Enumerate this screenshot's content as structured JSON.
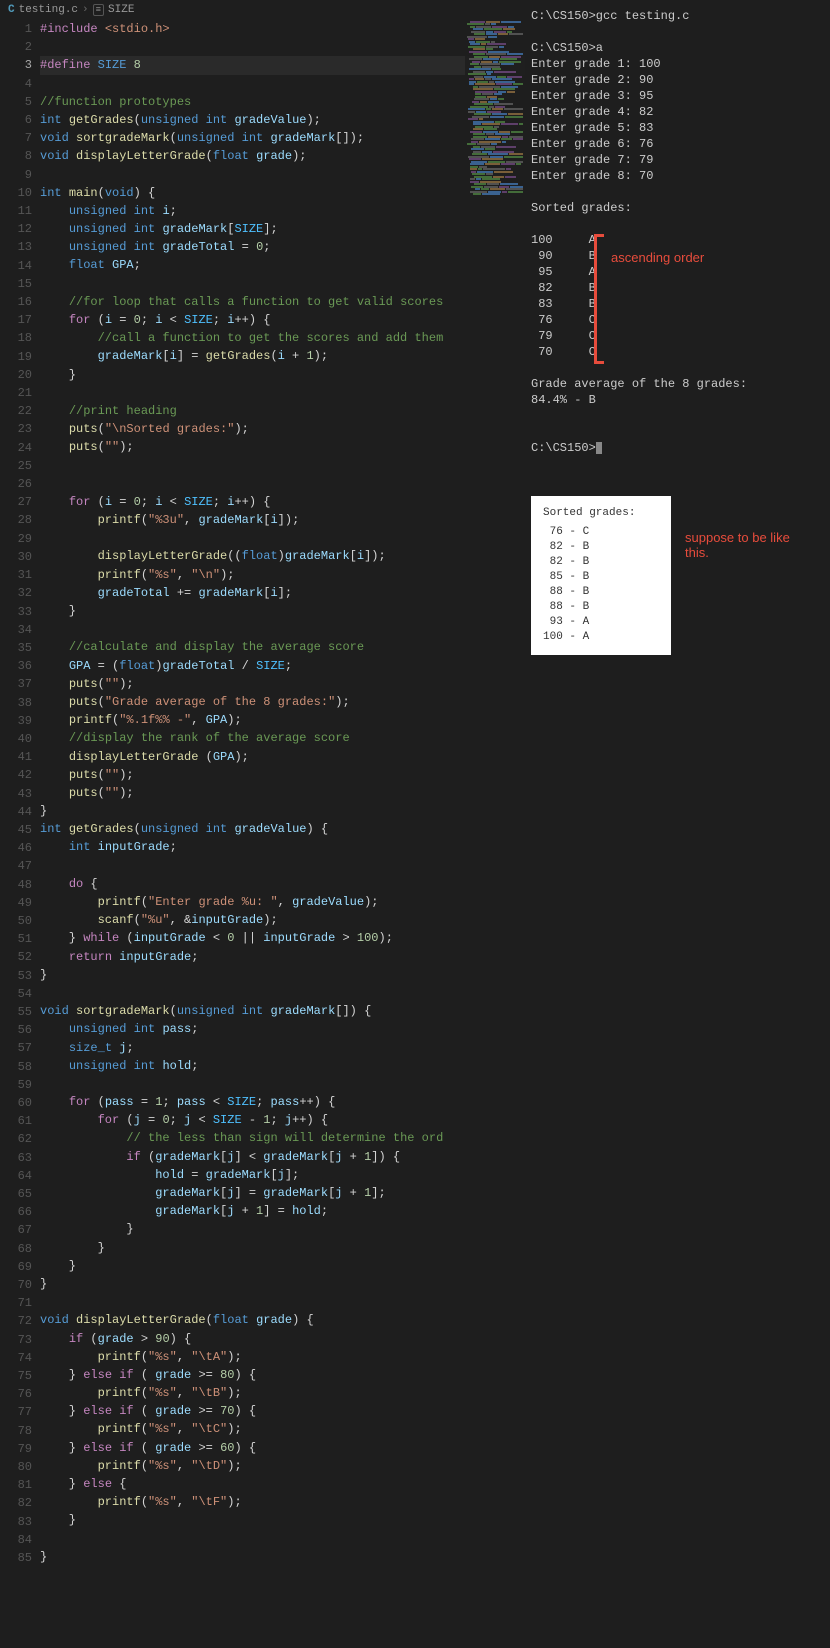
{
  "breadcrumb": {
    "icon": "C",
    "file": "testing.c",
    "symbol_icon": "SIZE",
    "symbol": "SIZE"
  },
  "code_lines": [
    {
      "n": 1,
      "h": "<span class='tk-include'>#include</span> <span class='tk-lib'>&lt;stdio.h&gt;</span>"
    },
    {
      "n": 2,
      "h": ""
    },
    {
      "n": 3,
      "h": "<span class='tk-include'>#define</span> <span class='tk-macro'>SIZE</span> <span class='tk-num'>8</span>",
      "active": true
    },
    {
      "n": 4,
      "h": ""
    },
    {
      "n": 5,
      "h": "<span class='tk-comment'>//function prototypes</span>"
    },
    {
      "n": 6,
      "h": "<span class='tk-type'>int</span> <span class='tk-func'>getGrades</span>(<span class='tk-type'>unsigned int</span> <span class='tk-var'>gradeValue</span>);"
    },
    {
      "n": 7,
      "h": "<span class='tk-type'>void</span> <span class='tk-func'>sortgradeMark</span>(<span class='tk-type'>unsigned int</span> <span class='tk-var'>gradeMark</span>[]);"
    },
    {
      "n": 8,
      "h": "<span class='tk-type'>void</span> <span class='tk-func'>displayLetterGrade</span>(<span class='tk-type'>float</span> <span class='tk-var'>grade</span>);"
    },
    {
      "n": 9,
      "h": ""
    },
    {
      "n": 10,
      "h": "<span class='tk-type'>int</span> <span class='tk-func'>main</span>(<span class='tk-type'>void</span>) {"
    },
    {
      "n": 11,
      "h": "    <span class='tk-type'>unsigned int</span> <span class='tk-var'>i</span>;"
    },
    {
      "n": 12,
      "h": "    <span class='tk-type'>unsigned int</span> <span class='tk-var'>gradeMark</span>[<span class='tk-const'>SIZE</span>];"
    },
    {
      "n": 13,
      "h": "    <span class='tk-type'>unsigned int</span> <span class='tk-var'>gradeTotal</span> = <span class='tk-num'>0</span>;"
    },
    {
      "n": 14,
      "h": "    <span class='tk-type'>float</span> <span class='tk-var'>GPA</span>;"
    },
    {
      "n": 15,
      "h": ""
    },
    {
      "n": 16,
      "h": "    <span class='tk-comment'>//for loop that calls a function to get valid scores</span>"
    },
    {
      "n": 17,
      "h": "    <span class='tk-ctrl'>for</span> (<span class='tk-var'>i</span> = <span class='tk-num'>0</span>; <span class='tk-var'>i</span> &lt; <span class='tk-const'>SIZE</span>; <span class='tk-var'>i</span>++) {"
    },
    {
      "n": 18,
      "h": "        <span class='tk-comment'>//call a function to get the scores and add them</span>"
    },
    {
      "n": 19,
      "h": "        <span class='tk-var'>gradeMark</span>[<span class='tk-var'>i</span>] = <span class='tk-func'>getGrades</span>(<span class='tk-var'>i</span> + <span class='tk-num'>1</span>);"
    },
    {
      "n": 20,
      "h": "    }"
    },
    {
      "n": 21,
      "h": ""
    },
    {
      "n": 22,
      "h": "    <span class='tk-comment'>//print heading</span>"
    },
    {
      "n": 23,
      "h": "    <span class='tk-func'>puts</span>(<span class='tk-str'>\"\\nSorted grades:\"</span>);"
    },
    {
      "n": 24,
      "h": "    <span class='tk-func'>puts</span>(<span class='tk-str'>\"\"</span>);"
    },
    {
      "n": 25,
      "h": ""
    },
    {
      "n": 26,
      "h": ""
    },
    {
      "n": 27,
      "h": "    <span class='tk-ctrl'>for</span> (<span class='tk-var'>i</span> = <span class='tk-num'>0</span>; <span class='tk-var'>i</span> &lt; <span class='tk-const'>SIZE</span>; <span class='tk-var'>i</span>++) {"
    },
    {
      "n": 28,
      "h": "        <span class='tk-func'>printf</span>(<span class='tk-str'>\"%3u\"</span>, <span class='tk-var'>gradeMark</span>[<span class='tk-var'>i</span>]);"
    },
    {
      "n": 29,
      "h": ""
    },
    {
      "n": 30,
      "h": "        <span class='tk-func'>displayLetterGrade</span>((<span class='tk-type'>float</span>)<span class='tk-var'>gradeMark</span>[<span class='tk-var'>i</span>]);"
    },
    {
      "n": 31,
      "h": "        <span class='tk-func'>printf</span>(<span class='tk-str'>\"%s\"</span>, <span class='tk-str'>\"\\n\"</span>);"
    },
    {
      "n": 32,
      "h": "        <span class='tk-var'>gradeTotal</span> += <span class='tk-var'>gradeMark</span>[<span class='tk-var'>i</span>];"
    },
    {
      "n": 33,
      "h": "    }"
    },
    {
      "n": 34,
      "h": ""
    },
    {
      "n": 35,
      "h": "    <span class='tk-comment'>//calculate and display the average score</span>"
    },
    {
      "n": 36,
      "h": "    <span class='tk-var'>GPA</span> = (<span class='tk-type'>float</span>)<span class='tk-var'>gradeTotal</span> / <span class='tk-const'>SIZE</span>;"
    },
    {
      "n": 37,
      "h": "    <span class='tk-func'>puts</span>(<span class='tk-str'>\"\"</span>);"
    },
    {
      "n": 38,
      "h": "    <span class='tk-func'>puts</span>(<span class='tk-str'>\"Grade average of the 8 grades:\"</span>);"
    },
    {
      "n": 39,
      "h": "    <span class='tk-func'>printf</span>(<span class='tk-str'>\"%.1f%% -\"</span>, <span class='tk-var'>GPA</span>);"
    },
    {
      "n": 40,
      "h": "    <span class='tk-comment'>//display the rank of the average score</span>"
    },
    {
      "n": 41,
      "h": "    <span class='tk-func'>displayLetterGrade</span> (<span class='tk-var'>GPA</span>);"
    },
    {
      "n": 42,
      "h": "    <span class='tk-func'>puts</span>(<span class='tk-str'>\"\"</span>);"
    },
    {
      "n": 43,
      "h": "    <span class='tk-func'>puts</span>(<span class='tk-str'>\"\"</span>);"
    },
    {
      "n": 44,
      "h": "}"
    },
    {
      "n": 45,
      "h": "<span class='tk-type'>int</span> <span class='tk-func'>getGrades</span>(<span class='tk-type'>unsigned int</span> <span class='tk-var'>gradeValue</span>) {"
    },
    {
      "n": 46,
      "h": "    <span class='tk-type'>int</span> <span class='tk-var'>inputGrade</span>;"
    },
    {
      "n": 47,
      "h": ""
    },
    {
      "n": 48,
      "h": "    <span class='tk-ctrl'>do</span> {"
    },
    {
      "n": 49,
      "h": "        <span class='tk-func'>printf</span>(<span class='tk-str'>\"Enter grade %u: \"</span>, <span class='tk-var'>gradeValue</span>);"
    },
    {
      "n": 50,
      "h": "        <span class='tk-func'>scanf</span>(<span class='tk-str'>\"%u\"</span>, &amp;<span class='tk-var'>inputGrade</span>);"
    },
    {
      "n": 51,
      "h": "    } <span class='tk-ctrl'>while</span> (<span class='tk-var'>inputGrade</span> &lt; <span class='tk-num'>0</span> || <span class='tk-var'>inputGrade</span> &gt; <span class='tk-num'>100</span>);"
    },
    {
      "n": 52,
      "h": "    <span class='tk-ctrl'>return</span> <span class='tk-var'>inputGrade</span>;"
    },
    {
      "n": 53,
      "h": "}"
    },
    {
      "n": 54,
      "h": ""
    },
    {
      "n": 55,
      "h": "<span class='tk-type'>void</span> <span class='tk-func'>sortgradeMark</span>(<span class='tk-type'>unsigned int</span> <span class='tk-var'>gradeMark</span>[]) {"
    },
    {
      "n": 56,
      "h": "    <span class='tk-type'>unsigned int</span> <span class='tk-var'>pass</span>;"
    },
    {
      "n": 57,
      "h": "    <span class='tk-type'>size_t</span> <span class='tk-var'>j</span>;"
    },
    {
      "n": 58,
      "h": "    <span class='tk-type'>unsigned int</span> <span class='tk-var'>hold</span>;"
    },
    {
      "n": 59,
      "h": ""
    },
    {
      "n": 60,
      "h": "    <span class='tk-ctrl'>for</span> (<span class='tk-var'>pass</span> = <span class='tk-num'>1</span>; <span class='tk-var'>pass</span> &lt; <span class='tk-const'>SIZE</span>; <span class='tk-var'>pass</span>++) {"
    },
    {
      "n": 61,
      "h": "        <span class='tk-ctrl'>for</span> (<span class='tk-var'>j</span> = <span class='tk-num'>0</span>; <span class='tk-var'>j</span> &lt; <span class='tk-const'>SIZE</span> - <span class='tk-num'>1</span>; <span class='tk-var'>j</span>++) {"
    },
    {
      "n": 62,
      "h": "            <span class='tk-comment'>// the less than sign will determine the ord</span>"
    },
    {
      "n": 63,
      "h": "            <span class='tk-ctrl'>if</span> (<span class='tk-var'>gradeMark</span>[<span class='tk-var'>j</span>] &lt; <span class='tk-var'>gradeMark</span>[<span class='tk-var'>j</span> + <span class='tk-num'>1</span>]) {"
    },
    {
      "n": 64,
      "h": "                <span class='tk-var'>hold</span> = <span class='tk-var'>gradeMark</span>[<span class='tk-var'>j</span>];"
    },
    {
      "n": 65,
      "h": "                <span class='tk-var'>gradeMark</span>[<span class='tk-var'>j</span>] = <span class='tk-var'>gradeMark</span>[<span class='tk-var'>j</span> + <span class='tk-num'>1</span>];"
    },
    {
      "n": 66,
      "h": "                <span class='tk-var'>gradeMark</span>[<span class='tk-var'>j</span> + <span class='tk-num'>1</span>] = <span class='tk-var'>hold</span>;"
    },
    {
      "n": 67,
      "h": "            }"
    },
    {
      "n": 68,
      "h": "        }"
    },
    {
      "n": 69,
      "h": "    }"
    },
    {
      "n": 70,
      "h": "}"
    },
    {
      "n": 71,
      "h": ""
    },
    {
      "n": 72,
      "h": "<span class='tk-type'>void</span> <span class='tk-func'>displayLetterGrade</span>(<span class='tk-type'>float</span> <span class='tk-var'>grade</span>) {"
    },
    {
      "n": 73,
      "h": "    <span class='tk-ctrl'>if</span> (<span class='tk-var'>grade</span> &gt; <span class='tk-num'>90</span>) {"
    },
    {
      "n": 74,
      "h": "        <span class='tk-func'>printf</span>(<span class='tk-str'>\"%s\"</span>, <span class='tk-str'>\"\\tA\"</span>);"
    },
    {
      "n": 75,
      "h": "    } <span class='tk-ctrl'>else if</span> ( <span class='tk-var'>grade</span> &gt;= <span class='tk-num'>80</span>) {"
    },
    {
      "n": 76,
      "h": "        <span class='tk-func'>printf</span>(<span class='tk-str'>\"%s\"</span>, <span class='tk-str'>\"\\tB\"</span>);"
    },
    {
      "n": 77,
      "h": "    } <span class='tk-ctrl'>else if</span> ( <span class='tk-var'>grade</span> &gt;= <span class='tk-num'>70</span>) {"
    },
    {
      "n": 78,
      "h": "        <span class='tk-func'>printf</span>(<span class='tk-str'>\"%s\"</span>, <span class='tk-str'>\"\\tC\"</span>);"
    },
    {
      "n": 79,
      "h": "    } <span class='tk-ctrl'>else if</span> ( <span class='tk-var'>grade</span> &gt;= <span class='tk-num'>60</span>) {"
    },
    {
      "n": 80,
      "h": "        <span class='tk-func'>printf</span>(<span class='tk-str'>\"%s\"</span>, <span class='tk-str'>\"\\tD\"</span>);"
    },
    {
      "n": 81,
      "h": "    } <span class='tk-ctrl'>else</span> {"
    },
    {
      "n": 82,
      "h": "        <span class='tk-func'>printf</span>(<span class='tk-str'>\"%s\"</span>, <span class='tk-str'>\"\\tF\"</span>);"
    },
    {
      "n": 83,
      "h": "    }"
    },
    {
      "n": 84,
      "h": ""
    },
    {
      "n": 85,
      "h": "}"
    }
  ],
  "terminal": {
    "lines": [
      "C:\\CS150>gcc testing.c",
      "",
      "C:\\CS150>a",
      "Enter grade 1: 100",
      "Enter grade 2: 90",
      "Enter grade 3: 95",
      "Enter grade 4: 82",
      "Enter grade 5: 83",
      "Enter grade 6: 76",
      "Enter grade 7: 79",
      "Enter grade 8: 70",
      "",
      "Sorted grades:",
      "",
      "100     A",
      " 90     B",
      " 95     A",
      " 82     B",
      " 83     B",
      " 76     C",
      " 79     C",
      " 70     C",
      "",
      "Grade average of the 8 grades:",
      "84.4% - B",
      "",
      "",
      "C:\\CS150>"
    ],
    "has_cursor": true
  },
  "annotations": {
    "ascending": "ascending order",
    "suppose": "suppose to be like this."
  },
  "expected": {
    "title": "Sorted grades:",
    "rows": [
      " 76 - C",
      " 82 - B",
      " 82 - B",
      " 85 - B",
      " 88 - B",
      " 88 - B",
      " 93 - A",
      "100 - A"
    ]
  }
}
